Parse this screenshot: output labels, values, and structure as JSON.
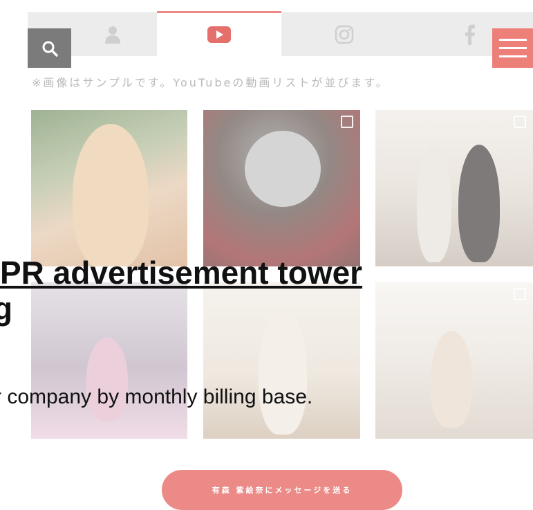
{
  "tabs": {
    "user_icon": "user-icon",
    "youtube_icon": "youtube-icon",
    "instagram_icon": "instagram-icon",
    "facebook_icon": "facebook-icon",
    "active": "youtube"
  },
  "header": {
    "search_icon": "search-icon",
    "menu_icon": "hamburger-menu-icon"
  },
  "note": "※画像はサンプルです。YouTubeの動画リストが並びます。",
  "gallery": {
    "items": [
      {
        "alt": "portrait"
      },
      {
        "alt": "yakiniku dinner"
      },
      {
        "alt": "two women"
      },
      {
        "alt": "studio shoot"
      },
      {
        "alt": "woman standing"
      },
      {
        "alt": "photo studio"
      }
    ]
  },
  "overlay": {
    "title_line1": "PR advertisement tower",
    "title_line2": "g",
    "description": "r company by monthly billing base."
  },
  "cta": {
    "label": "有森 紫絵奈にメッセージを送る"
  },
  "colors": {
    "accent": "#ec8a87",
    "menu_bg": "#ed7f79",
    "search_bg": "#7b7b7b",
    "tabbar_bg": "#ececec"
  }
}
